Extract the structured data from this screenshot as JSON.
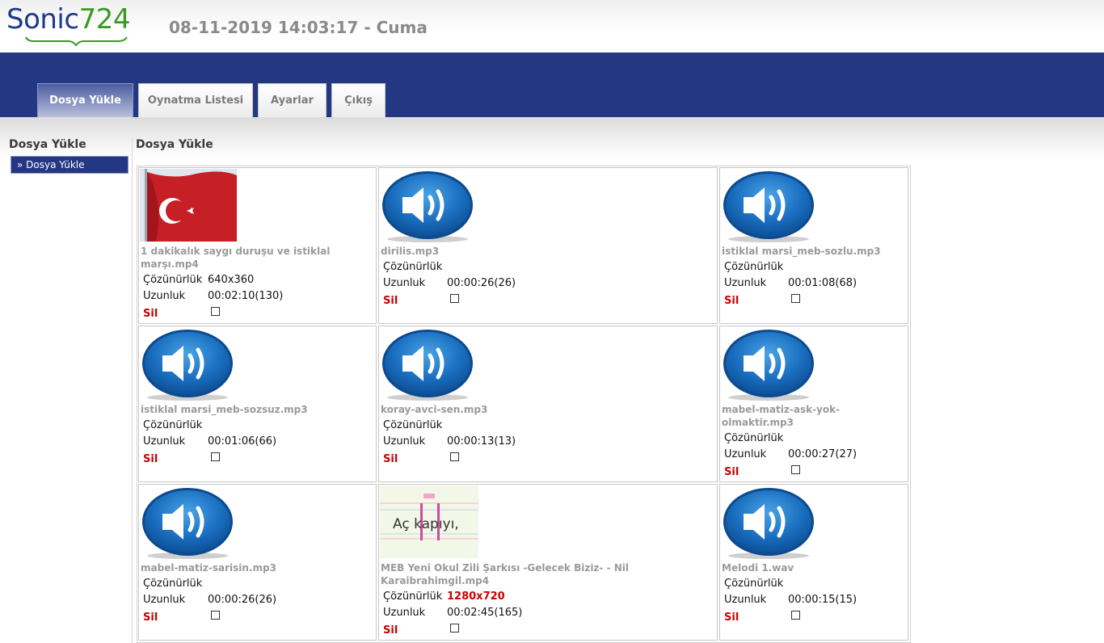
{
  "app": {
    "logo_sonic": "Sonic",
    "logo_num": "724"
  },
  "header": {
    "datetime": "08-11-2019 14:03:17 - Cuma"
  },
  "tabs": [
    {
      "label": "Dosya Yükle",
      "active": true
    },
    {
      "label": "Oynatma Listesi"
    },
    {
      "label": "Ayarlar"
    },
    {
      "label": "Çıkış"
    }
  ],
  "sidebar": {
    "title": "Dosya Yükle",
    "items": [
      {
        "label": "» Dosya Yükle"
      }
    ]
  },
  "main": {
    "title": "Dosya Yükle"
  },
  "labels": {
    "resolution": "Çözünürlük",
    "duration": "Uzunluk",
    "delete": "Sil"
  },
  "files": [
    {
      "name": "1 dakikalık saygı duruşu ve istiklal marşı.mp4",
      "name_lines": [
        "1 dakikalık saygı duruşu ve istiklal",
        "marşı.mp4"
      ],
      "resolution": "640x360",
      "duration": "00:02:10(130)",
      "thumb": "flag-image"
    },
    {
      "name": "dirilis.mp3",
      "name_lines": [
        "dirilis.mp3"
      ],
      "resolution": "",
      "duration": "00:00:26(26)",
      "thumb": "speaker-icon"
    },
    {
      "name": "istiklal marsi_meb-sozlu.mp3",
      "name_lines": [
        "istiklal marsi_meb-sozlu.mp3"
      ],
      "resolution": "",
      "duration": "00:01:08(68)",
      "thumb": "speaker-icon"
    },
    {
      "name": "istiklal marsi_meb-sozsuz.mp3",
      "name_lines": [
        "istiklal marsi_meb-sozsuz.mp3"
      ],
      "resolution": "",
      "duration": "00:01:06(66)",
      "thumb": "speaker-icon"
    },
    {
      "name": "koray-avci-sen.mp3",
      "name_lines": [
        "koray-avci-sen.mp3"
      ],
      "resolution": "",
      "duration": "00:00:13(13)",
      "thumb": "speaker-icon"
    },
    {
      "name": "mabel-matiz-ask-yok-olmaktir.mp3",
      "name_lines": [
        "mabel-matiz-ask-yok-",
        "olmaktir.mp3"
      ],
      "resolution": "",
      "duration": "00:00:27(27)",
      "thumb": "speaker-icon"
    },
    {
      "name": "mabel-matiz-sarisin.mp3",
      "name_lines": [
        "mabel-matiz-sarisin.mp3"
      ],
      "resolution": "",
      "duration": "00:00:26(26)",
      "thumb": "speaker-icon"
    },
    {
      "name": "MEB Yeni Okul Zili Şarkısı -Gelecek Biziz- - Nil Karaibrahimgil.mp4",
      "name_lines": [
        "MEB Yeni Okul Zili Şarkısı -Gelecek Biziz- - Nil",
        "Karaibrahimgil.mp4"
      ],
      "resolution": "1280x720",
      "resolution_highlight": true,
      "duration": "00:02:45(165)",
      "thumb": "video-image",
      "thumb_text": "Aç kapıyı,"
    },
    {
      "name": "Melodi 1.wav",
      "name_lines": [
        "Melodi 1.wav"
      ],
      "resolution": "",
      "duration": "00:00:15(15)",
      "thumb": "speaker-icon"
    }
  ]
}
